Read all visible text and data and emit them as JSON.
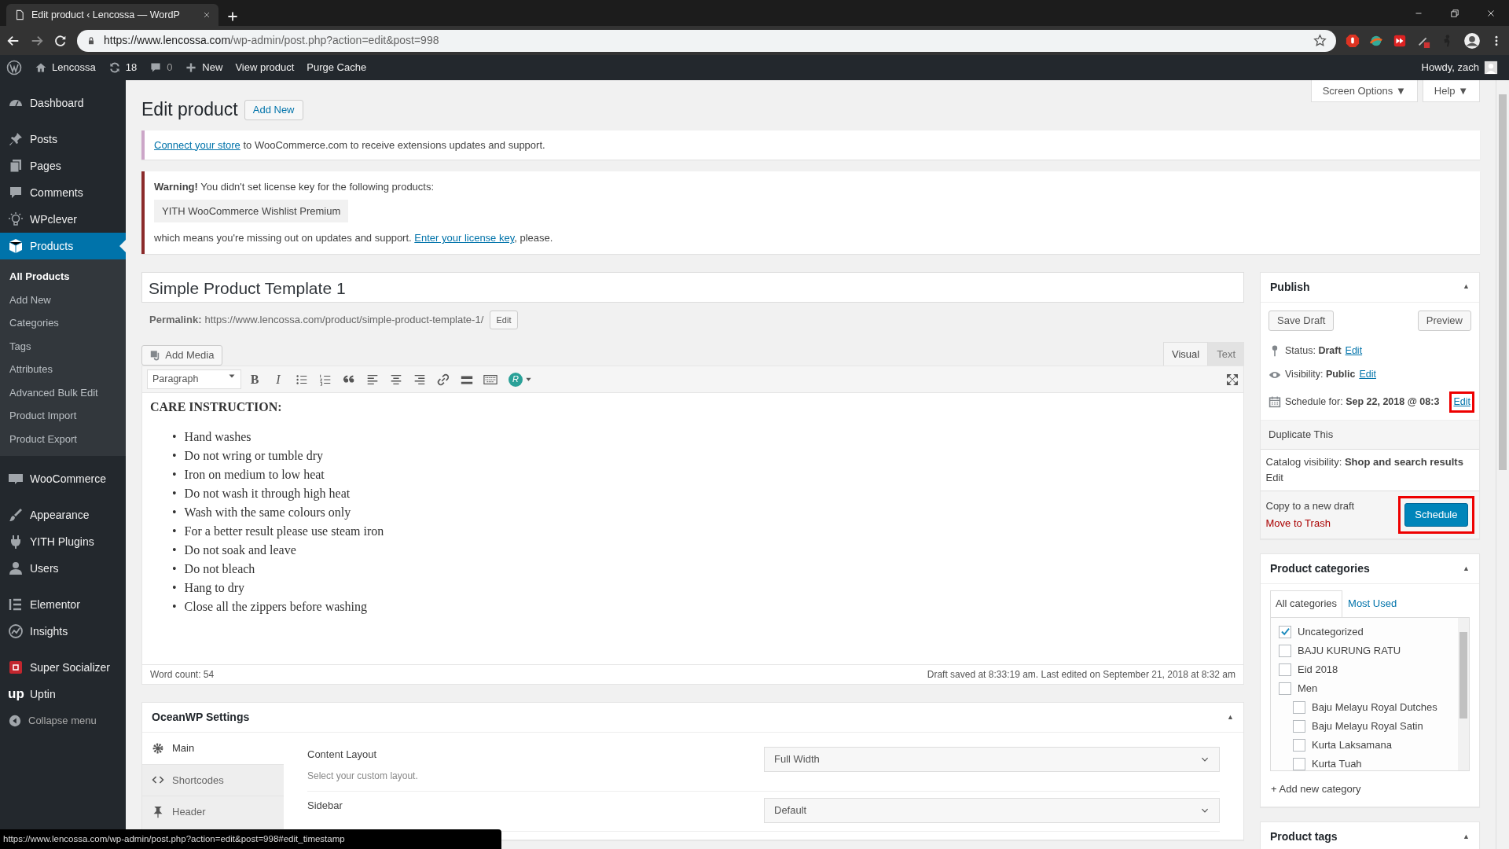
{
  "browser": {
    "tab_title": "Edit product ‹ Lencossa — WordP",
    "url_host": "https://www.lencossa.com",
    "url_path": "/wp-admin/post.php?action=edit&post=998",
    "status_url": "https://www.lencossa.com/wp-admin/post.php?action=edit&post=998#edit_timestamp"
  },
  "admin_bar": {
    "site": "Lencossa",
    "updates": "18",
    "comments": "0",
    "new": "New",
    "links": [
      "View product",
      "Purge Cache"
    ],
    "howdy": "Howdy, zach"
  },
  "sidebar": {
    "groups": [
      [
        {
          "label": "Dashboard",
          "selected": false
        }
      ],
      [
        {
          "label": "Posts",
          "selected": false
        },
        {
          "label": "Pages",
          "selected": false
        },
        {
          "label": "Comments",
          "selected": false
        },
        {
          "label": "WPclever",
          "selected": false
        },
        {
          "label": "Products",
          "selected": true,
          "submenu": [
            {
              "label": "All Products",
              "selected": true
            },
            {
              "label": "Add New",
              "selected": false
            },
            {
              "label": "Categories",
              "selected": false
            },
            {
              "label": "Tags",
              "selected": false
            },
            {
              "label": "Attributes",
              "selected": false
            },
            {
              "label": "Advanced Bulk Edit",
              "selected": false
            },
            {
              "label": "Product Import",
              "selected": false
            },
            {
              "label": "Product Export",
              "selected": false
            }
          ]
        }
      ],
      [
        {
          "label": "WooCommerce",
          "selected": false
        }
      ],
      [
        {
          "label": "Appearance",
          "selected": false
        },
        {
          "label": "YITH Plugins",
          "selected": false
        },
        {
          "label": "Users",
          "selected": false
        }
      ],
      [
        {
          "label": "Elementor",
          "selected": false
        },
        {
          "label": "Insights",
          "selected": false
        }
      ],
      [
        {
          "label": "Super Socializer",
          "selected": false
        },
        {
          "label": "Uptin",
          "selected": false,
          "logo_text": "up"
        }
      ]
    ],
    "collapse": "Collapse menu"
  },
  "screen_tabs": [
    "Screen Options ▼",
    "Help ▼"
  ],
  "page": {
    "title": "Edit product",
    "add_new": "Add New"
  },
  "notices": [
    {
      "kind": "info",
      "link": "Connect your store",
      "text": " to WooCommerce.com to receive extensions updates and support."
    },
    {
      "kind": "warning",
      "headline": "**Warning!** You didn't set license key for the following products:",
      "product": "YITH WooCommerce Wishlist Premium",
      "text": "which means you're missing out on updates and support. ",
      "link": "Enter your license key",
      "after": ", please."
    }
  ],
  "post_title": "Simple Product Template 1",
  "permalink": {
    "label": "Permalink:",
    "url": "https://www.lencossa.com/product/simple-product-template-1/",
    "edit": "Edit"
  },
  "editor": {
    "add_media": "Add Media",
    "tabs": [
      {
        "label": "Visual",
        "selected": true
      },
      {
        "label": "Text",
        "selected": false
      }
    ],
    "format": "Paragraph",
    "glyph_buttons": [
      "B",
      "I"
    ],
    "plugin_letter": "R",
    "heading": "CARE INSTRUCTION:",
    "marker": "•",
    "items": [
      "Hand washes",
      "Do not wring or tumble dry",
      "Iron on medium to low heat",
      "Do not wash it through high heat",
      "Wash with the same colours only",
      "For a better result please use steam iron",
      "Do not soak and leave",
      "Do not bleach",
      "Hang to dry",
      "Close all the zippers before washing"
    ],
    "word_count": "Word count: 54",
    "saved": "Draft saved at 8:33:19 am. Last edited on September 21, 2018 at 8:32 am"
  },
  "oceanwp": {
    "title": "OceanWP Settings",
    "collapse_arrow": "▲",
    "tabs": [
      {
        "label": "Main",
        "selected": true
      },
      {
        "label": "Shortcodes",
        "selected": false
      },
      {
        "label": "Header",
        "selected": false
      }
    ],
    "fields": [
      {
        "label": "Content Layout",
        "description": "Select your custom layout.",
        "value": "Full Width"
      },
      {
        "label": "Sidebar",
        "value": "Default"
      }
    ]
  },
  "publish": {
    "title": "Publish",
    "collapse_arrow": "▲",
    "save_draft": "Save Draft",
    "preview": "Preview",
    "rows": [
      {
        "label": "Status:",
        "value": "Draft",
        "edit": "Edit",
        "highlighted": false
      },
      {
        "label": "Visibility:",
        "value": "Public",
        "edit": "Edit",
        "highlighted": false
      },
      {
        "label": "Schedule for:",
        "value": "Sep 22, 2018 @ 08:3",
        "edit": "Edit",
        "highlighted": true
      }
    ],
    "duplicate": "Duplicate This",
    "catalog_label": "Catalog visibility:",
    "catalog_value": "Shop and search results",
    "catalog_edit": "Edit",
    "copy": "Copy to a new draft",
    "trash": "Move to Trash",
    "submit": "Schedule",
    "submit_highlighted": true
  },
  "categories": {
    "title": "Product categories",
    "collapse_arrow": "▲",
    "tabs": [
      {
        "label": "All categories",
        "selected": true
      },
      {
        "label": "Most Used",
        "selected": false
      }
    ],
    "items": [
      {
        "label": "Uncategorized",
        "checked": true
      },
      {
        "label": "BAJU KURUNG RATU",
        "checked": false
      },
      {
        "label": "Eid 2018",
        "checked": false
      },
      {
        "label": "Men",
        "checked": false,
        "children": [
          {
            "label": "Baju Melayu Royal Dutches",
            "checked": false
          },
          {
            "label": "Baju Melayu Royal Satin",
            "checked": false
          },
          {
            "label": "Kurta Laksamana",
            "checked": false
          },
          {
            "label": "Kurta Tuah",
            "checked": false
          }
        ]
      }
    ],
    "add_new": "+ Add new category"
  },
  "tags_box": {
    "title": "Product tags",
    "collapse_arrow": "▲"
  }
}
